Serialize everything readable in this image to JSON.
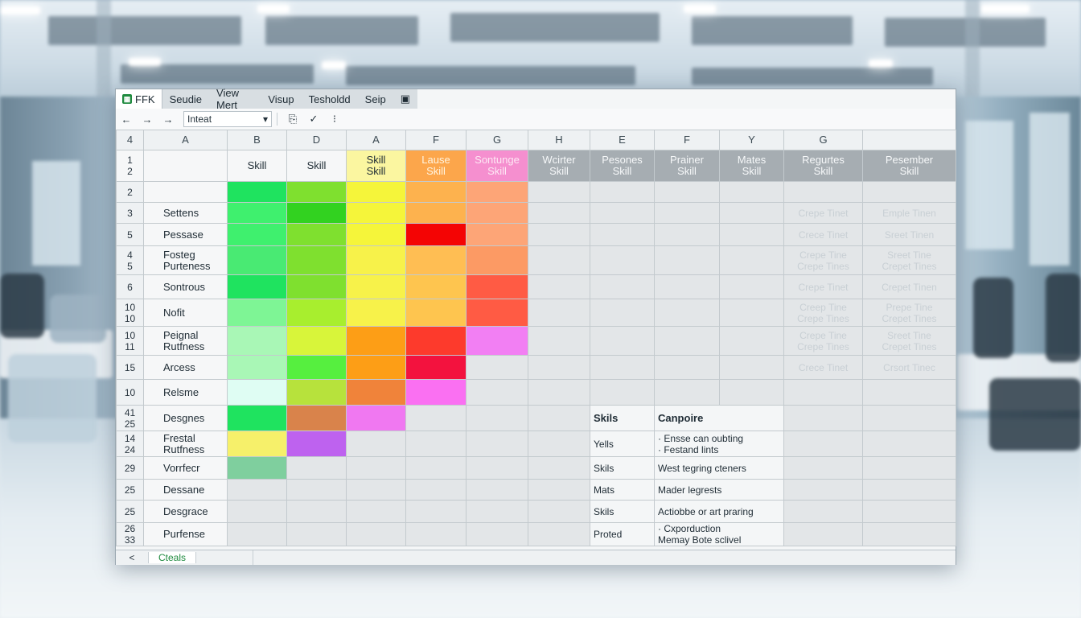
{
  "app": {
    "name": "FFK"
  },
  "menu": [
    "Seudie",
    "View Mert",
    "Visup",
    "Tesholdd",
    "Seip"
  ],
  "toolbar": {
    "back": "←",
    "forward1": "→",
    "forward2": "→",
    "font": "Inteat",
    "clip": "⎘",
    "check": "✓",
    "more": "⁝"
  },
  "columns": [
    "A",
    "B",
    "D",
    "A",
    "F",
    "G",
    "H",
    "E",
    "F",
    "Y",
    "G",
    ""
  ],
  "header_row": {
    "rownum": "1\n2",
    "cells": [
      "Skill",
      "Skill",
      "Skill\nSkill",
      "Lause\nSkill",
      "Sontunge\nSkill",
      "Wcirter\nSkill",
      "Pesones\nSkill",
      "Prainer\nSkill",
      "Mates\nSkill",
      "Regurtes\nSkill",
      "Pesember\nSkill"
    ]
  },
  "colors": {
    "g1": "#1fe35f",
    "g2": "#3ff06e",
    "g3": "#49ea73",
    "g4": "#7ef595",
    "g5": "#a9f7b6",
    "g6": "#dffdf3",
    "gt": "#7fcf9e",
    "l1": "#7fe02f",
    "l2": "#32d220",
    "l3": "#a8ee2e",
    "l4": "#d8f53a",
    "l5": "#56ef3f",
    "l6": "#b7e23c",
    "y1": "#f5f53a",
    "y2": "#f7f24a",
    "y3": "#f7e940",
    "y4": "#f3ea50",
    "o1": "#fdb24e",
    "o2": "#ffbe53",
    "o3": "#fec54f",
    "o4": "#fd9e16",
    "o5": "#f0833a",
    "ob": "#d9834b",
    "r1": "#f40404",
    "r2": "#fd3a2c",
    "r3": "#f3123e",
    "r4": "#ff5b44",
    "p1": "#f27ff3",
    "p2": "#fa70f2",
    "p3": "#f078f1",
    "pv": "#be62ef",
    "s1": "#fda577",
    "s2": "#fc9a64",
    "s3": "#fb9b6c",
    "hdrY": "#fbf6a0",
    "hdrO": "#fca64b",
    "hdrP": "#f58fcf",
    "pale": "#f6f06a"
  },
  "rows": [
    {
      "num": "2",
      "name": "",
      "colors": [
        "g1",
        "l1",
        "y1",
        "o1",
        "s1"
      ],
      "extra": []
    },
    {
      "num": "3",
      "name": "Settens",
      "colors": [
        "g2",
        "l2",
        "y1",
        "o1",
        "s1"
      ],
      "extra": [
        "Crepe Tinet",
        "Emple Tinen"
      ]
    },
    {
      "num": "5",
      "name": "Pessase",
      "colors": [
        "g2",
        "l1",
        "y1",
        "r1",
        "s1"
      ],
      "extra": [
        "Crece Tinet",
        "Sreet Tinen"
      ]
    },
    {
      "num": "4\n5",
      "name": "Fosteg\nPurteness",
      "colors": [
        "g3",
        "l1",
        "y2",
        "o2",
        "s2"
      ],
      "extra": [
        "Crepe Tine\nCrepe Tines",
        "Sreet Tine\nCrepet Tines"
      ]
    },
    {
      "num": "6",
      "name": "Sontrous",
      "colors": [
        "g1",
        "l1",
        "y2",
        "o3",
        "r4"
      ],
      "extra": [
        "Crepe Tinet",
        "Crepet Tinen"
      ]
    },
    {
      "num": "10\n10",
      "name": "Nofit",
      "colors": [
        "g4",
        "l3",
        "y2",
        "o3",
        "r4"
      ],
      "extra": [
        "Creep Tine\nCrepe Tines",
        "Prepe Tine\nCrepet Tines"
      ]
    },
    {
      "num": "10\n11",
      "name": "Peignal\nRutfness",
      "colors": [
        "g5",
        "l4",
        "o4",
        "r2",
        "p1"
      ],
      "extra": [
        "Crepe Tine\nCrepe Tines",
        "Sreet Tine\nCrepet Tines"
      ]
    },
    {
      "num": "15",
      "name": "Arcess",
      "colors": [
        "g5",
        "l5",
        "o4",
        "r3",
        ""
      ],
      "extra": [
        "Crece Tinet",
        "Crsort Tinec"
      ]
    },
    {
      "num": "10",
      "name": "Relsme",
      "colors": [
        "g6",
        "l6",
        "o5",
        "p2",
        ""
      ],
      "extra": []
    },
    {
      "num": "41\n25",
      "name": "Desgnes",
      "colors": [
        "g1",
        "ob",
        "p3",
        "",
        ""
      ],
      "lower": [
        "Skils",
        "Canpoire"
      ],
      "lowerBold": true
    },
    {
      "num": "14\n24",
      "name": "Frestal\nRutfness",
      "colors": [
        "pale",
        "pv",
        "",
        "",
        ""
      ],
      "lower": [
        "Yells",
        "· Ensse can oubting\n· Festand lints"
      ]
    },
    {
      "num": "29",
      "name": "Vorrfecr",
      "colors": [
        "gt",
        "",
        "",
        "",
        ""
      ],
      "lower": [
        "Skils",
        "West tegring cteners"
      ]
    },
    {
      "num": "25",
      "name": "Dessane",
      "colors": [
        "",
        "",
        "",
        "",
        ""
      ],
      "lower": [
        "Mats",
        "Mader legrests"
      ]
    },
    {
      "num": "25",
      "name": "Desgrace",
      "colors": [
        "",
        "",
        "",
        "",
        ""
      ],
      "lower": [
        "Skils",
        "Actiobbe or art praring"
      ]
    },
    {
      "num": "26\n33",
      "name": "Purfense",
      "colors": [
        "",
        "",
        "",
        "",
        ""
      ],
      "lower": [
        "Proted",
        "· Cxporduction\nMemay Bote sclivel"
      ]
    }
  ],
  "sheetbar": {
    "nav": "<",
    "tab": "Cteals"
  }
}
